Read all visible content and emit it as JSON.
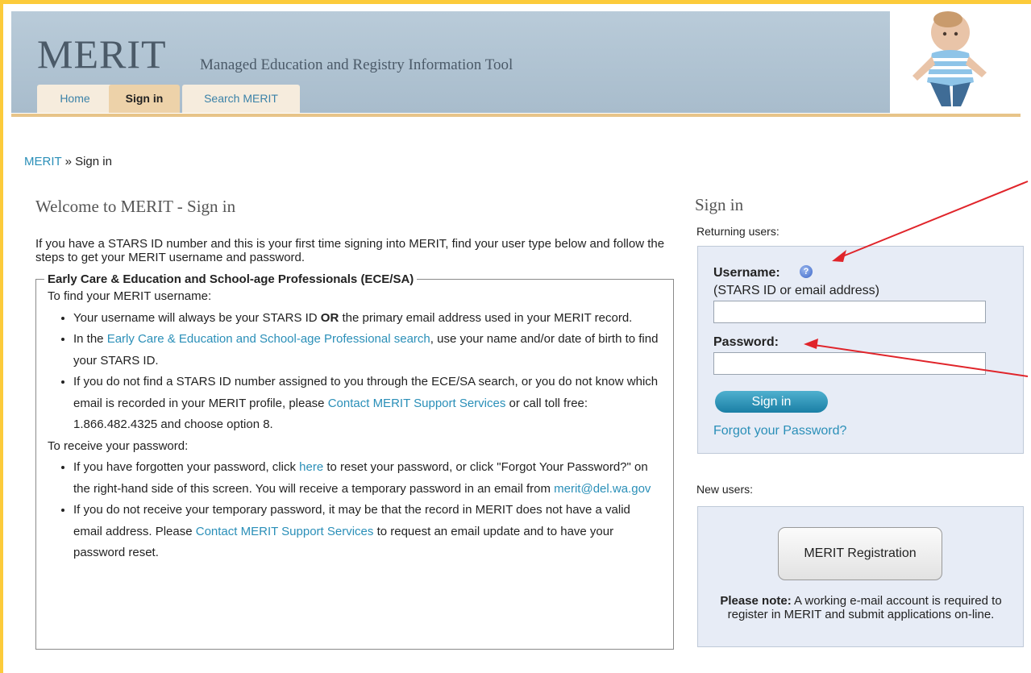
{
  "header": {
    "logo": "MERIT",
    "tagline": "Managed Education and Registry Information Tool",
    "tabs": [
      {
        "label": "Home",
        "active": false
      },
      {
        "label": "Sign in",
        "active": true
      },
      {
        "label": "Search MERIT",
        "active": false
      }
    ]
  },
  "breadcrumb": {
    "root": "MERIT",
    "separator": "»",
    "current": "Sign in"
  },
  "main": {
    "title": "Welcome to MERIT - Sign in",
    "intro": "If you have a STARS ID number and this is your first time signing into MERIT, find your user type below and follow the steps to get your MERIT username and password.",
    "section": {
      "legend": "Early Care & Education and School-age Professionals (ECE/SA)",
      "username_heading": "To find your MERIT username:",
      "u1_a": "Your username will always be your STARS ID",
      "u1_bold": "OR",
      "u1_b": "the primary email address used in your MERIT record.",
      "u2_a": "In the",
      "u2_link": "Early Care & Education and School-age Professional search",
      "u2_b": ", use your name and/or date of birth to find your STARS ID.",
      "u3_a": "If you do not find a STARS ID number assigned to you through the ECE/SA search, or you do not know which email is recorded in your MERIT profile, please",
      "u3_link": "Contact MERIT Support Services",
      "u3_b": "or call toll free: 1.866.482.4325 and choose option 8.",
      "password_heading": "To receive your password:",
      "p1_a": "If you have forgotten your password, click",
      "p1_link": "here",
      "p1_b": "to reset your password, or click \"Forgot Your Password?\" on the right-hand side of this screen. You will receive a temporary password in an email from",
      "p1_email": "merit@del.wa.gov",
      "p2_a": "If you do not receive your temporary password, it may be that the record in MERIT does not have a valid email address. Please",
      "p2_link": "Contact MERIT Support Services",
      "p2_b": "to request an email update and to have your password reset."
    }
  },
  "signin": {
    "title": "Sign in",
    "returning_label": "Returning users:",
    "username_label": "Username:",
    "username_hint": "(STARS ID or email address)",
    "username_value": "",
    "password_label": "Password:",
    "password_value": "",
    "button": "Sign in",
    "forgot": "Forgot your Password?"
  },
  "new_users": {
    "label": "New users:",
    "button": "MERIT Registration",
    "note_bold": "Please note:",
    "note_text": "A working e-mail account is required to register in MERIT and submit applications on-line."
  },
  "colors": {
    "frame": "#fccb3a",
    "link": "#2a8fb8",
    "header": "#b1c4d3",
    "panel": "#e7ecf6",
    "annotation_arrow": "#e0242a"
  }
}
